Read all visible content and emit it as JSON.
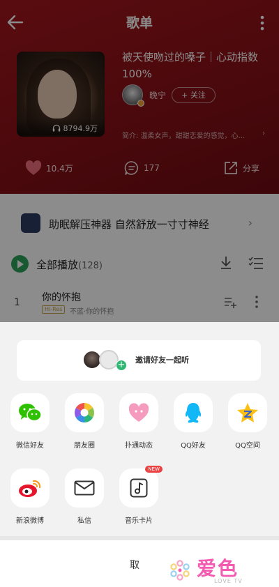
{
  "header": {
    "title": "歌单"
  },
  "playlist": {
    "cover_play_count": "8794.9万",
    "name": "被天使吻过的嗓子｜心动指数100%",
    "creator": "晚宁",
    "follow_label": "+ 关注",
    "intro": "简介: 温柔女声，甜甜恋爱的感觉，心..."
  },
  "actions": {
    "like_count": "10.4万",
    "comment_count": "177",
    "share_label": "分享"
  },
  "banner": {
    "text": "助眠解压神器 自然舒放一寸寸神经"
  },
  "playall": {
    "label": "全部播放",
    "count": "(128)"
  },
  "songs": [
    {
      "index": "1",
      "title": "你的怀抱",
      "quality": "Hi-Res",
      "subtitle": "不蓝·你的怀抱"
    }
  ],
  "share_sheet": {
    "invite_label": "邀请好友一起听",
    "items": [
      {
        "label": "微信好友",
        "icon": "wechat-icon"
      },
      {
        "label": "朋友圈",
        "icon": "moments-icon"
      },
      {
        "label": "扑通动态",
        "icon": "putong-icon"
      },
      {
        "label": "QQ好友",
        "icon": "qq-icon"
      },
      {
        "label": "QQ空间",
        "icon": "qzone-icon"
      },
      {
        "label": "新浪微博",
        "icon": "weibo-icon"
      },
      {
        "label": "私信",
        "icon": "mail-icon"
      },
      {
        "label": "音乐卡片",
        "icon": "music-card-icon"
      }
    ],
    "new_badge": "NEW",
    "cancel_label": "取"
  },
  "watermark": {
    "main": "爱色",
    "sub": "LOVE TV"
  },
  "colors": {
    "header_red": "#8e1219",
    "play_green": "#2ea35a",
    "badge_red": "#ec4141",
    "watermark_pink": "#f25bb0"
  }
}
